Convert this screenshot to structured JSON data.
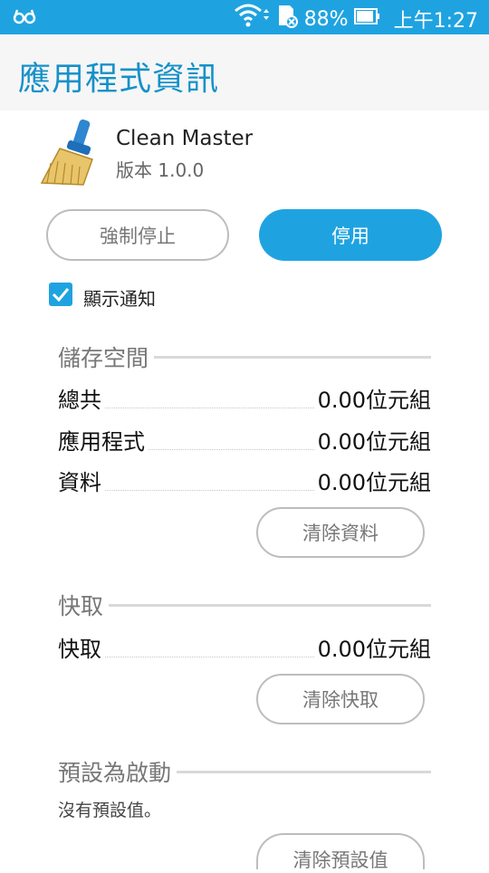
{
  "status_bar": {
    "battery_percent": "88%",
    "time": "上午1:27",
    "icons": [
      "glasses-icon",
      "wifi-icon",
      "sd-card-icon",
      "battery-icon"
    ]
  },
  "header": {
    "title": "應用程式資訊"
  },
  "app": {
    "name": "Clean Master",
    "version": "版本 1.0.0",
    "icon": "broom-icon"
  },
  "actions": {
    "force_stop": "強制停止",
    "disable": "停用"
  },
  "notification": {
    "label": "顯示通知",
    "checked": true
  },
  "storage": {
    "title": "儲存空間",
    "rows": [
      {
        "label": "總共",
        "value": "0.00位元組"
      },
      {
        "label": "應用程式",
        "value": "0.00位元組"
      },
      {
        "label": "資料",
        "value": "0.00位元組"
      }
    ],
    "clear_button": "清除資料"
  },
  "cache": {
    "title": "快取",
    "rows": [
      {
        "label": "快取",
        "value": "0.00位元組"
      }
    ],
    "clear_button": "清除快取"
  },
  "launch_default": {
    "title": "預設為啟動",
    "description": "沒有預設值。",
    "clear_button": "清除預設值"
  },
  "colors": {
    "accent": "#1fa3e0",
    "title": "#1591c9"
  }
}
